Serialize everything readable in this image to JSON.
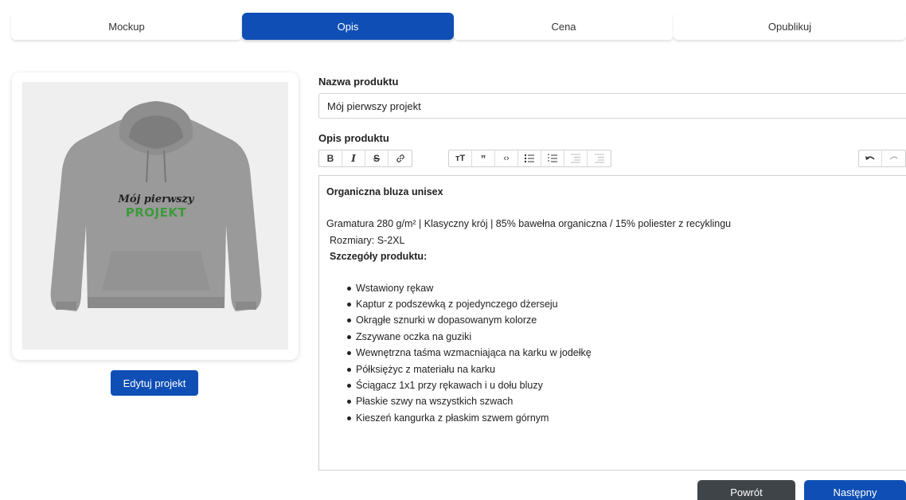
{
  "tabs": [
    {
      "label": "Mockup"
    },
    {
      "label": "Opis"
    },
    {
      "label": "Cena"
    },
    {
      "label": "Opublikuj"
    }
  ],
  "active_tab": "Opis",
  "preview": {
    "design_line1": "Mój pierwszy",
    "design_line2": "PROJEKT",
    "edit_button": "Edytuj projekt",
    "product_color": "#9a9a9a",
    "accent_green": "#3c9a3c"
  },
  "form": {
    "name_label": "Nazwa produktu",
    "name_value": "Mój pierwszy projekt",
    "desc_label": "Opis produktu"
  },
  "toolbar": {
    "formatting": [
      "bold-icon",
      "italic-icon",
      "strikethrough-icon",
      "link-icon"
    ],
    "block": [
      "heading-icon",
      "quote-icon",
      "code-icon",
      "bullet-list-icon",
      "numbered-list-icon",
      "outdent-icon",
      "indent-icon"
    ],
    "history": [
      "undo-icon",
      "redo-icon"
    ]
  },
  "description": {
    "title": "Organiczna bluza unisex",
    "specs": "Gramatura 280 g/m² | Klasyczny krój | 85% bawełna organiczna / 15% poliester z recyklingu",
    "sizes": "Rozmiary: S-2XL",
    "details_heading": "Szczegóły produktu:",
    "features": [
      "Wstawiony rękaw",
      "Kaptur z podszewką z pojedynczego dżerseju",
      "Okrągłe sznurki w dopasowanym kolorze",
      "Zszywane oczka na guziki",
      "Wewnętrzna taśma wzmacniająca na karku w jodełkę",
      "Półksiężyc z materiału na karku",
      "Ściągacz 1x1 przy rękawach i u dołu bluzy",
      "Płaskie szwy na wszystkich szwach",
      "Kieszeń kangurka z płaskim szwem górnym"
    ]
  },
  "nav": {
    "back": "Powrót",
    "next": "Następny"
  },
  "colors": {
    "primary": "#0f4fb5",
    "secondary": "#3f4448"
  }
}
